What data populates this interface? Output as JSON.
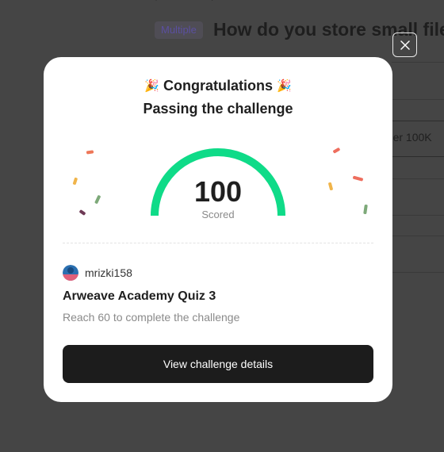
{
  "background": {
    "question_type_badge": "Multiple",
    "question_title": "How do you store small file",
    "option_partial_text": "nder 100K"
  },
  "modal": {
    "title": "Congratulations",
    "title_icon": "party-popper-icon",
    "subtitle": "Passing the challenge",
    "score": {
      "value": "100",
      "label": "Scored",
      "fraction": 1.0,
      "gauge_color": "#0fdb88"
    },
    "user": {
      "name": "mrizki158",
      "avatar_icon": "user-avatar-icon"
    },
    "quiz": {
      "title": "Arweave Academy Quiz 3",
      "description": "Reach 60 to complete the challenge"
    },
    "cta_label": "View challenge details"
  },
  "colors": {
    "accent_green": "#0fdb88",
    "overlay": "#454545",
    "button_dark": "#1c1c1c"
  }
}
